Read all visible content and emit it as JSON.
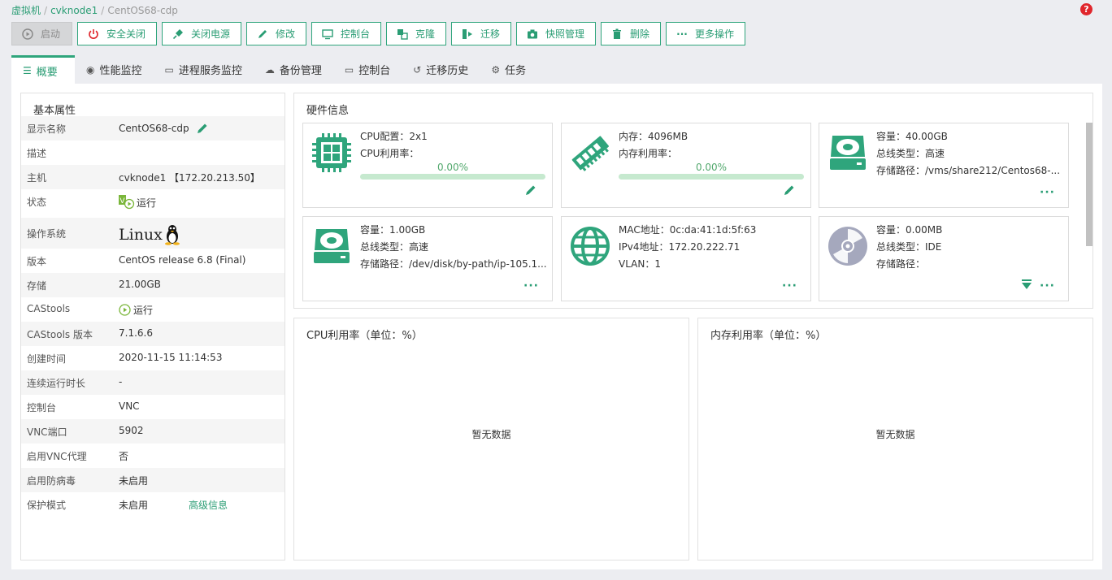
{
  "breadcrumb": {
    "root": "虚拟机",
    "host": "cvknode1",
    "vm": "CentOS68-cdp"
  },
  "toolbar": {
    "start": "启动",
    "safe_shutdown": "安全关闭",
    "power_off": "关闭电源",
    "modify": "修改",
    "console": "控制台",
    "clone": "克隆",
    "migrate": "迁移",
    "snapshot": "快照管理",
    "delete": "删除",
    "more": "更多操作"
  },
  "tabs": {
    "overview": "概要",
    "perf": "性能监控",
    "process": "进程服务监控",
    "backup": "备份管理",
    "console": "控制台",
    "migration_history": "迁移历史",
    "tasks": "任务"
  },
  "basic": {
    "title": "基本属性",
    "rows": [
      {
        "k": "显示名称",
        "v": "CentOS68-cdp"
      },
      {
        "k": "描述",
        "v": ""
      },
      {
        "k": "主机",
        "v": "cvknode1 【172.20.213.50】"
      },
      {
        "k": "状态",
        "v": "运行"
      },
      {
        "k": "操作系统",
        "v": "Linux"
      },
      {
        "k": "版本",
        "v": "CentOS release 6.8 (Final)"
      },
      {
        "k": "存储",
        "v": "21.00GB"
      },
      {
        "k": "CAStools",
        "v": "运行"
      },
      {
        "k": "CAStools 版本",
        "v": "7.1.6.6"
      },
      {
        "k": "创建时间",
        "v": "2020-11-15 11:14:53"
      },
      {
        "k": "连续运行时长",
        "v": "-"
      },
      {
        "k": "控制台",
        "v": "VNC"
      },
      {
        "k": "VNC端口",
        "v": "5902"
      },
      {
        "k": "启用VNC代理",
        "v": "否"
      },
      {
        "k": "启用防病毒",
        "v": "未启用"
      },
      {
        "k": "保护模式",
        "v": "未启用"
      }
    ],
    "advanced_link": "高级信息"
  },
  "hardware": {
    "title": "硬件信息",
    "cpu": {
      "config": "CPU配置：2x1",
      "usage_label": "CPU利用率：",
      "usage": "0.00%",
      "usage_fraction": 0
    },
    "memory": {
      "size": "内存：4096MB",
      "usage_label": "内存利用率：",
      "usage": "0.00%",
      "usage_fraction": 0
    },
    "disk1": {
      "capacity": "容量：40.00GB",
      "bus": "总线类型：高速",
      "path": "存储路径：/vms/share212/Centos68-..."
    },
    "disk2": {
      "capacity": "容量：1.00GB",
      "bus": "总线类型：高速",
      "path": "存储路径：/dev/disk/by-path/ip-105.1..."
    },
    "nic": {
      "mac": "MAC地址：0c:da:41:1d:5f:63",
      "ipv4": "IPv4地址：172.20.222.71",
      "vlan": "VLAN：1"
    },
    "cdrom": {
      "capacity": "容量：0.00MB",
      "bus": "总线类型：IDE",
      "path": "存储路径："
    }
  },
  "charts": {
    "cpu_title": "CPU利用率（单位：%）",
    "mem_title": "内存利用率（单位：%）",
    "no_data": "暂无数据"
  },
  "colors": {
    "accent": "#2fa57c",
    "danger": "#e0262c"
  }
}
